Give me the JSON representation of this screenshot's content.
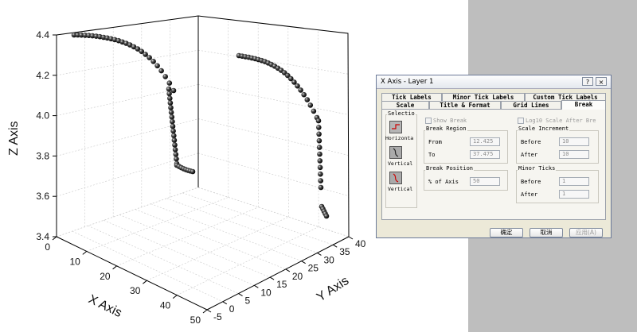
{
  "plot": {
    "axis_labels": {
      "x": "X Axis",
      "y": "Y Axis",
      "z": "Z Axis"
    },
    "x_ticks": [
      "0",
      "10",
      "20",
      "30",
      "40",
      "50"
    ],
    "y_ticks": [
      "-5",
      "0",
      "5",
      "10",
      "15",
      "20",
      "25",
      "30",
      "35",
      "40"
    ],
    "z_ticks": [
      "3.4",
      "3.6",
      "3.8",
      "4.0",
      "4.2",
      "4.4"
    ]
  },
  "dialog": {
    "title": "X Axis - Layer 1",
    "help_button": "?",
    "close_button": "×",
    "tabs_row1": [
      "Tick Labels",
      "Minor Tick Labels",
      "Custom Tick Labels"
    ],
    "tabs_row2": [
      "Scale",
      "Title & Format",
      "Grid Lines",
      "Break"
    ],
    "selection": {
      "title": "Selectio",
      "items": [
        "Horizonta",
        "Vertical",
        "Vertical"
      ]
    },
    "show_break_label": "Show Break",
    "break_region": {
      "title": "Break Region",
      "from_label": "From",
      "from_value": "12.425",
      "to_label": "To",
      "to_value": "37.475"
    },
    "break_position": {
      "title": "Break Position",
      "label": "% of Axis",
      "value": "50"
    },
    "log_scale_label": "Log10 Scale After Bre",
    "scale_increment": {
      "title": "Scale Increment",
      "before_label": "Before",
      "before_value": "10",
      "after_label": "After",
      "after_value": "10"
    },
    "minor_ticks": {
      "title": "Minor Ticks",
      "before_label": "Before",
      "before_value": "1",
      "after_label": "After",
      "after_value": "1"
    },
    "buttons": {
      "ok": "确定",
      "cancel": "取消",
      "apply": "应用(A)"
    }
  }
}
